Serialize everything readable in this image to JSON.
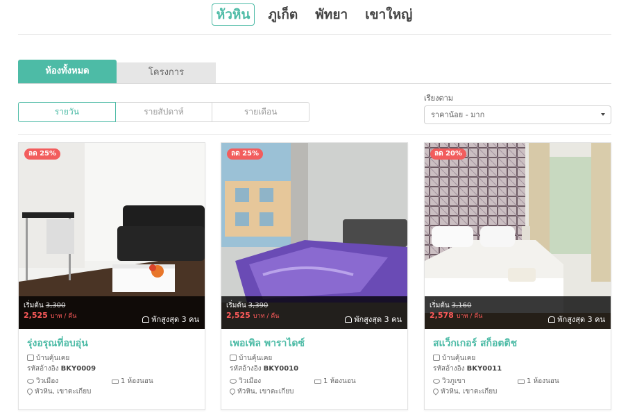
{
  "cities": [
    "หัวหิน",
    "ภูเก็ต",
    "พัทยา",
    "เขาใหญ่"
  ],
  "tabs": [
    "ห้องทั้งหมด",
    "โครงการ"
  ],
  "periods": [
    "รายวัน",
    "รายสัปดาห์",
    "รายเดือน"
  ],
  "sort": {
    "label": "เรียงตาม",
    "value": "ราคาน้อย - มาก"
  },
  "cards": [
    {
      "badge": "ลด 25%",
      "from_label": "เริ่มต้น",
      "old_price": "3,300",
      "price": "2,525",
      "price_unit": "บาท / คืน",
      "guests": "พักสูงสุด 3 คน",
      "name": "รุ่งอรุณที่อบอุ่น",
      "type": "บ้านคุ้นเคย",
      "ref_label": "รหัสอ้างอิง",
      "ref": "BKY0009",
      "view": "วิวเมือง",
      "rooms": "1 ห้องนอน",
      "location": "หัวหิน, เขาตะเกียบ"
    },
    {
      "badge": "ลด 25%",
      "from_label": "เริ่มต้น",
      "old_price": "3,390",
      "price": "2,525",
      "price_unit": "บาท / คืน",
      "guests": "พักสูงสุด 3 คน",
      "name": "เพอเพิล พาราไดซ์",
      "type": "บ้านคุ้นเคย",
      "ref_label": "รหัสอ้างอิง",
      "ref": "BKY0010",
      "view": "วิวเมือง",
      "rooms": "1 ห้องนอน",
      "location": "หัวหิน, เขาตะเกียบ"
    },
    {
      "badge": "ลด 20%",
      "from_label": "เริ่มต้น",
      "old_price": "3,160",
      "price": "2,578",
      "price_unit": "บาท / คืน",
      "guests": "พักสูงสุด 3 คน",
      "name": "สแว็กเกอร์ สก็อตติช",
      "type": "บ้านคุ้นเคย",
      "ref_label": "รหัสอ้างอิง",
      "ref": "BKY0011",
      "view": "วิวภูเขา",
      "rooms": "1 ห้องนอน",
      "location": "หัวหิน, เขาตะเกียบ"
    }
  ]
}
